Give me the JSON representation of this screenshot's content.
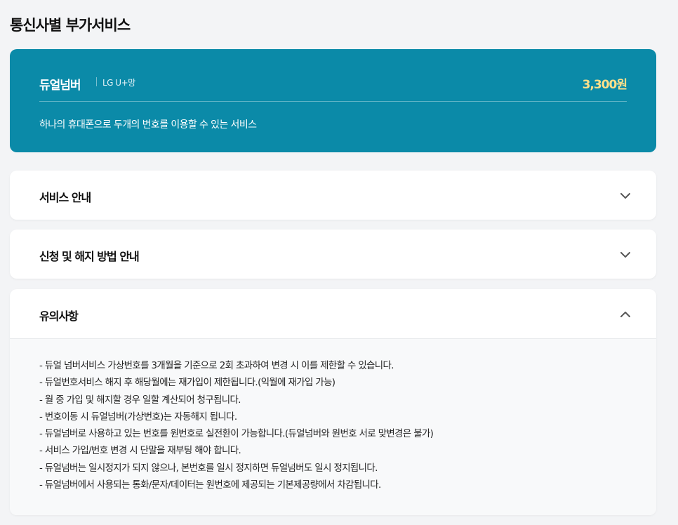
{
  "page_title": "통신사별 부가서비스",
  "service": {
    "name": "듀얼넘버",
    "carrier": "LG U+망",
    "price": "3,300원",
    "description": "하나의 휴대폰으로 두개의 번호를 이용할 수 있는 서비스"
  },
  "accordions": [
    {
      "title": "서비스 안내",
      "expanded": false,
      "icon": "chevron-down-icon"
    },
    {
      "title": "신청 및 해지 방법 안내",
      "expanded": false,
      "icon": "chevron-down-icon"
    },
    {
      "title": "유의사항",
      "expanded": true,
      "icon": "chevron-up-icon",
      "items": [
        "- 듀얼 넘버서비스 가상번호를 3개월을 기준으로 2회 초과하여 변경 시 이를 제한할 수 있습니다.",
        "- 듀얼번호서비스 해지 후 해당월에는 재가입이 제한됩니다.(익월에 재가입 가능)",
        "- 월 중 가입 및 해지할 경우 일할 계산되어 청구됩니다.",
        "- 번호이동 시 듀얼넘버(가상번호)는 자동해지 됩니다.",
        "- 듀얼넘버로 사용하고 있는 번호를 원번호로 실전환이 가능합니다.(듀얼넘버와 원번호 서로 맞변경은 불가)",
        "- 서비스 가입/번호 변경 시 단말을 재부팅 해야 합니다.",
        "- 듀얼넘버는 일시정지가 되지 않으나, 본번호를 일시 정지하면 듀얼넘버도 일시 정지됩니다.",
        "- 듀얼넘버에서 사용되는 통화/문자/데이터는 원번호에 제공되는 기본제공량에서 차감됩니다."
      ]
    }
  ],
  "colors": {
    "hero_bg": "#0b8aa8",
    "price": "#ffe08a",
    "page_bg": "#f3f4f6"
  }
}
